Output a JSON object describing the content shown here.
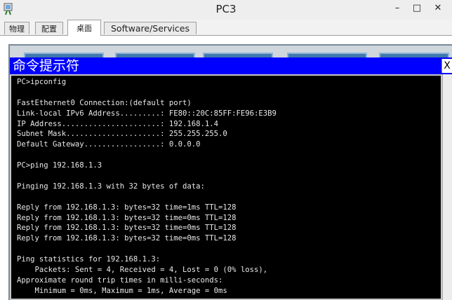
{
  "window": {
    "title": "PC3",
    "minimize_glyph": "–",
    "maximize_glyph": "□",
    "close_glyph": "✕",
    "icon": "packet-tracer-pc-icon"
  },
  "tabs": [
    {
      "label": "物理",
      "active": false
    },
    {
      "label": "配置",
      "active": false
    },
    {
      "label": "桌面",
      "active": true
    },
    {
      "label": "Software/Services",
      "active": false
    }
  ],
  "cmd": {
    "title": "命令提示符",
    "close_glyph": "X",
    "lines": [
      "PC>ipconfig",
      "",
      "FastEthernet0 Connection:(default port)",
      "Link-local IPv6 Address.........: FE80::20C:85FF:FE96:E3B9",
      "IP Address......................: 192.168.1.4",
      "Subnet Mask.....................: 255.255.255.0",
      "Default Gateway.................: 0.0.0.0",
      "",
      "PC>ping 192.168.1.3",
      "",
      "Pinging 192.168.1.3 with 32 bytes of data:",
      "",
      "Reply from 192.168.1.3: bytes=32 time=1ms TTL=128",
      "Reply from 192.168.1.3: bytes=32 time=0ms TTL=128",
      "Reply from 192.168.1.3: bytes=32 time=0ms TTL=128",
      "Reply from 192.168.1.3: bytes=32 time=0ms TTL=128",
      "",
      "Ping statistics for 192.168.1.3:",
      "    Packets: Sent = 4, Received = 4, Lost = 0 (0% loss),",
      "Approximate round trip times in milli-seconds:",
      "    Minimum = 0ms, Maximum = 1ms, Average = 0ms"
    ]
  },
  "colors": {
    "cmd_title_bg": "#0000ff",
    "terminal_bg": "#000000",
    "terminal_fg": "#e8e8e8"
  }
}
